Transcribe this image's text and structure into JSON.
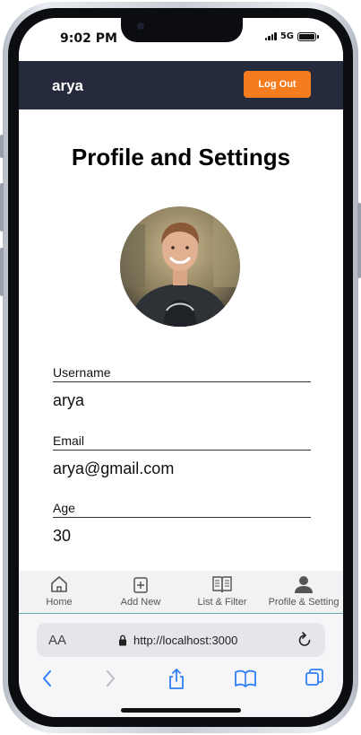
{
  "status": {
    "time": "9:02 PM",
    "network": "5G"
  },
  "header": {
    "brand": "arya",
    "logout_label": "Log Out"
  },
  "page": {
    "title": "Profile and Settings"
  },
  "fields": [
    {
      "label": "Username",
      "value": "arya"
    },
    {
      "label": "Email",
      "value": "arya@gmail.com"
    },
    {
      "label": "Age",
      "value": "30"
    }
  ],
  "tabs": [
    {
      "label": "Home",
      "icon": "home-icon"
    },
    {
      "label": "Add New",
      "icon": "add-square-icon"
    },
    {
      "label": "List & Filter",
      "icon": "book-icon"
    },
    {
      "label": "Profile & Setting",
      "icon": "user-icon"
    }
  ],
  "browser": {
    "text_size_label": "AA",
    "url": "http://localhost:3000"
  },
  "colors": {
    "header_bg": "#252b3c",
    "accent": "#f57c1f",
    "browser_blue": "#2f7ff7"
  }
}
